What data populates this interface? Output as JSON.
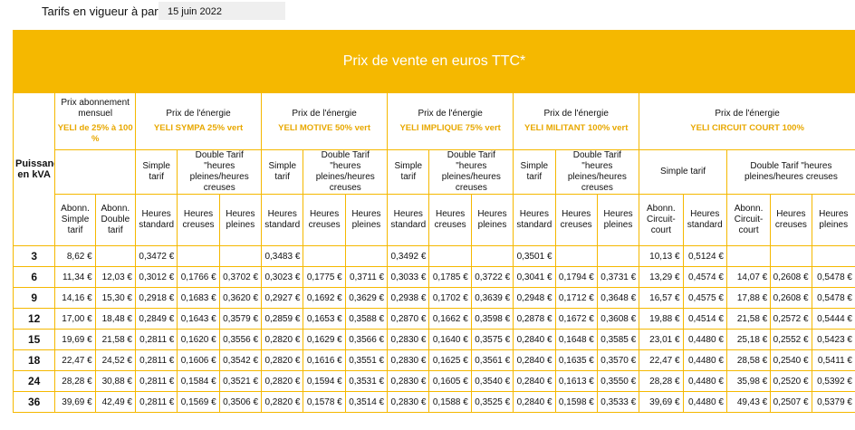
{
  "header": {
    "label": "Tarifs en vigueur à partir du",
    "date": "15 juin 2022"
  },
  "banner": {
    "title": "Prix de vente en euros TTC*"
  },
  "table": {
    "col0_header": "Puissance en kVA",
    "abonnement": {
      "title": "Prix abonnement mensuel",
      "subtitle": "YELI de 25% à 100 %"
    },
    "energy_title": "Prix de l'énergie",
    "offers": [
      "YELI SYMPA 25% vert",
      "YELI MOTIVE 50% vert",
      "YELI IMPLIQUE 75% vert",
      "YELI MILITANT 100% vert",
      "YELI CIRCUIT COURT 100%"
    ],
    "simple_label": "Simple tarif",
    "double_label": "Double Tarif \"heures pleines/heures creuses",
    "cc_simple_label": "Simple tarif",
    "cc_double_label": "Double Tarif \"heures pleines/heures creuses",
    "sub_headers": {
      "abonn_simple": "Abonn. Simple tarif",
      "abonn_double": "Abonn. Double tarif",
      "heures_standard": "Heures standard",
      "heures_creuses": "Heures creuses",
      "heures_pleines": "Heures pleines",
      "abonn_cc": "Abonn. Circuit-court",
      "abonn_cc2": "Abonn. Circuit-court"
    },
    "rows": [
      {
        "p": "3",
        "c": [
          "8,62 €",
          "",
          "0,3472 €",
          "",
          "",
          "0,3483 €",
          "",
          "",
          "0,3492 €",
          "",
          "",
          "0,3501 €",
          "",
          "",
          "10,13 €",
          "0,5124 €",
          "",
          "",
          ""
        ]
      },
      {
        "p": "6",
        "c": [
          "11,34 €",
          "12,03 €",
          "0,3012 €",
          "0,1766 €",
          "0,3702 €",
          "0,3023 €",
          "0,1775 €",
          "0,3711 €",
          "0,3033 €",
          "0,1785 €",
          "0,3722 €",
          "0,3041 €",
          "0,1794 €",
          "0,3731 €",
          "13,29 €",
          "0,4574 €",
          "14,07 €",
          "0,2608 €",
          "0,5478 €"
        ]
      },
      {
        "p": "9",
        "c": [
          "14,16 €",
          "15,30 €",
          "0,2918 €",
          "0,1683 €",
          "0,3620 €",
          "0,2927 €",
          "0,1692 €",
          "0,3629 €",
          "0,2938 €",
          "0,1702 €",
          "0,3639 €",
          "0,2948 €",
          "0,1712 €",
          "0,3648 €",
          "16,57 €",
          "0,4575 €",
          "17,88 €",
          "0,2608 €",
          "0,5478 €"
        ]
      },
      {
        "p": "12",
        "c": [
          "17,00 €",
          "18,48 €",
          "0,2849 €",
          "0,1643 €",
          "0,3579 €",
          "0,2859 €",
          "0,1653 €",
          "0,3588 €",
          "0,2870 €",
          "0,1662 €",
          "0,3598 €",
          "0,2878 €",
          "0,1672 €",
          "0,3608 €",
          "19,88 €",
          "0,4514 €",
          "21,58 €",
          "0,2572 €",
          "0,5444 €"
        ]
      },
      {
        "p": "15",
        "c": [
          "19,69 €",
          "21,58 €",
          "0,2811 €",
          "0,1620 €",
          "0,3556 €",
          "0,2820 €",
          "0,1629 €",
          "0,3566 €",
          "0,2830 €",
          "0,1640 €",
          "0,3575 €",
          "0,2840 €",
          "0,1648 €",
          "0,3585 €",
          "23,01 €",
          "0,4480 €",
          "25,18 €",
          "0,2552 €",
          "0,5423 €"
        ]
      },
      {
        "p": "18",
        "c": [
          "22,47 €",
          "24,52 €",
          "0,2811 €",
          "0,1606 €",
          "0,3542 €",
          "0,2820 €",
          "0,1616 €",
          "0,3551 €",
          "0,2830 €",
          "0,1625 €",
          "0,3561 €",
          "0,2840 €",
          "0,1635 €",
          "0,3570 €",
          "22,47 €",
          "0,4480 €",
          "28,58 €",
          "0,2540 €",
          "0,5411 €"
        ]
      },
      {
        "p": "24",
        "c": [
          "28,28 €",
          "30,88 €",
          "0,2811 €",
          "0,1584 €",
          "0,3521 €",
          "0,2820 €",
          "0,1594 €",
          "0,3531 €",
          "0,2830 €",
          "0,1605 €",
          "0,3540 €",
          "0,2840 €",
          "0,1613 €",
          "0,3550 €",
          "28,28 €",
          "0,4480 €",
          "35,98 €",
          "0,2520 €",
          "0,5392 €"
        ]
      },
      {
        "p": "36",
        "c": [
          "39,69 €",
          "42,49 €",
          "0,2811 €",
          "0,1569 €",
          "0,3506 €",
          "0,2820 €",
          "0,1578 €",
          "0,3514 €",
          "0,2830 €",
          "0,1588 €",
          "0,3525 €",
          "0,2840 €",
          "0,1598 €",
          "0,3533 €",
          "39,69 €",
          "0,4480 €",
          "49,43 €",
          "0,2507 €",
          "0,5379 €"
        ]
      }
    ]
  }
}
